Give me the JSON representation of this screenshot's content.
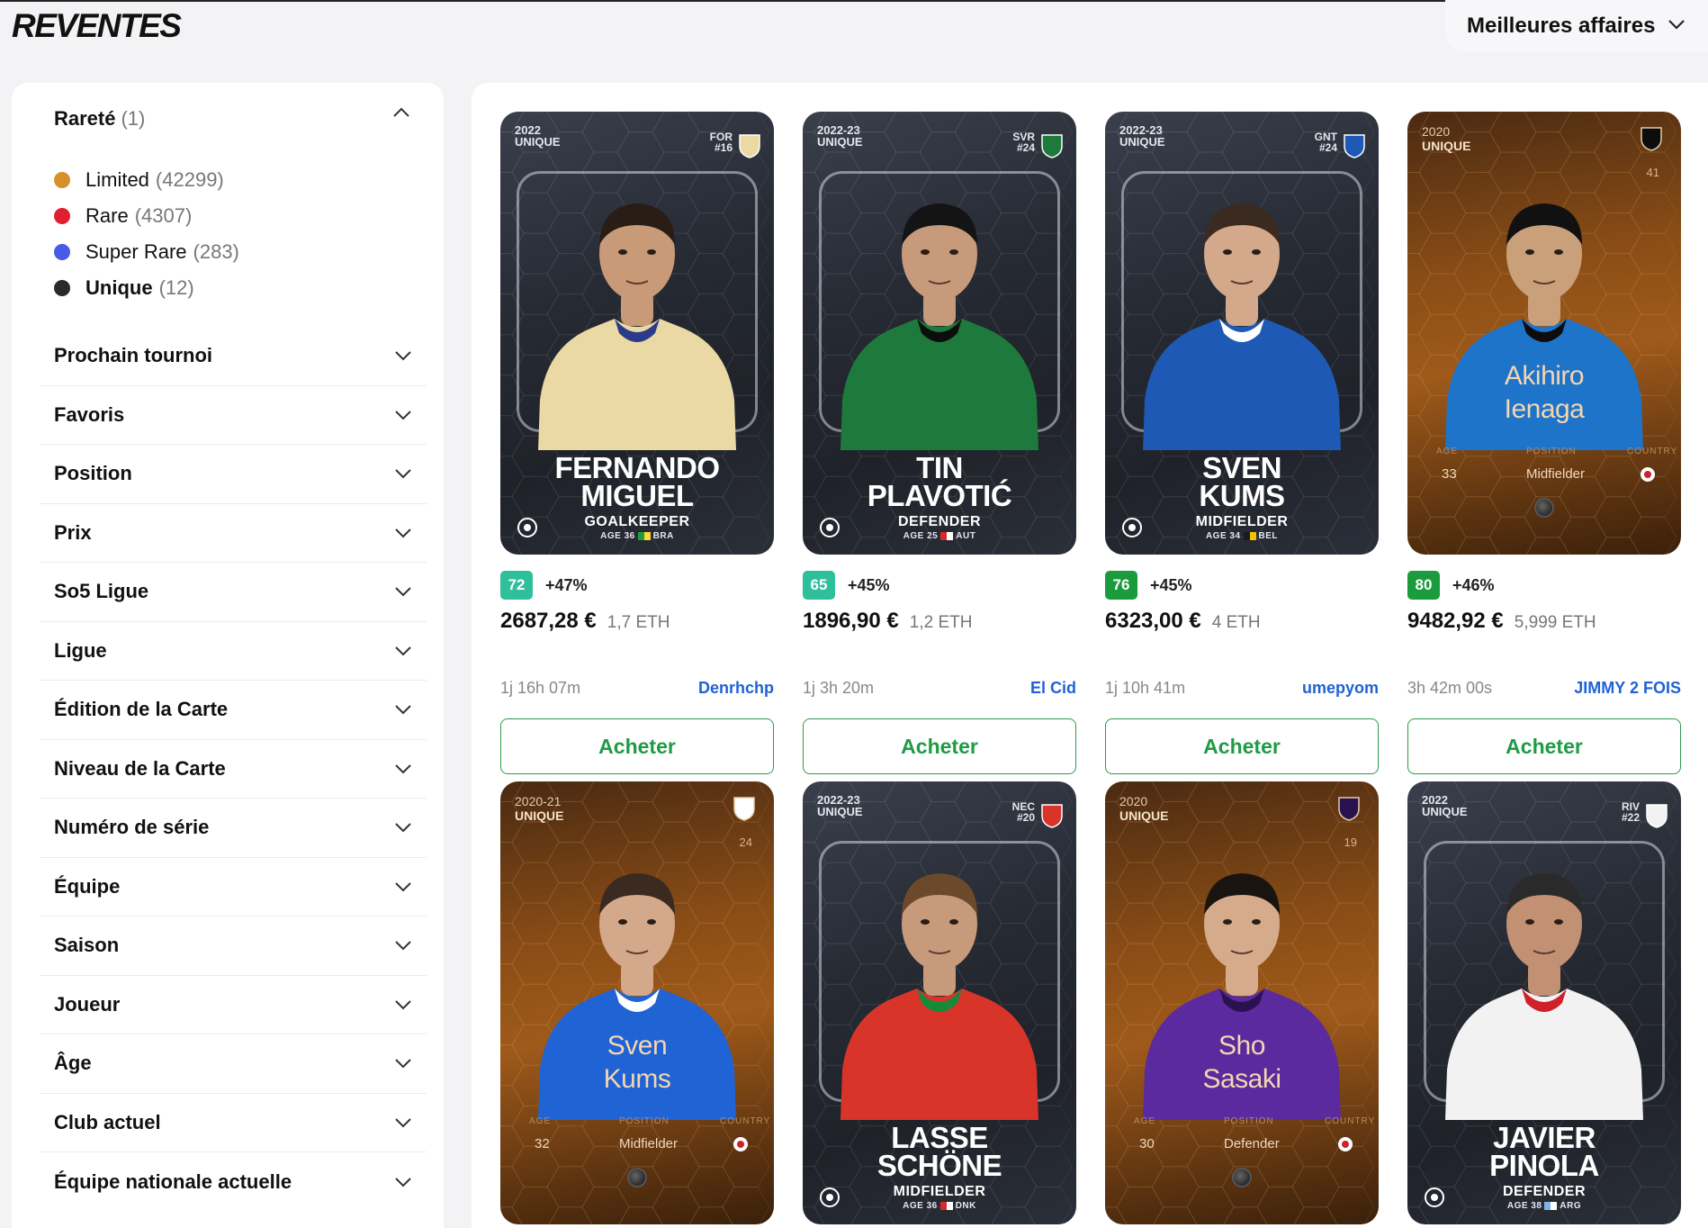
{
  "page": {
    "title": "REVENTES"
  },
  "sort": {
    "label": "Meilleures affaires"
  },
  "sidebar": {
    "rarete": {
      "label": "Rareté",
      "count": "(1)"
    },
    "rarities": [
      {
        "name": "Limited",
        "count": "(42299)",
        "color": "#d4912a"
      },
      {
        "name": "Rare",
        "count": "(4307)",
        "color": "#e02030"
      },
      {
        "name": "Super Rare",
        "count": "(283)",
        "color": "#4a5ae8"
      },
      {
        "name": "Unique",
        "count": "(12)",
        "color": "#2a2a2a"
      }
    ],
    "filters": [
      "Prochain tournoi",
      "Favoris",
      "Position",
      "Prix",
      "So5 Ligue",
      "Ligue",
      "Édition de la Carte",
      "Niveau de la Carte",
      "Numéro de série",
      "Équipe",
      "Saison",
      "Joueur",
      "Âge",
      "Club actuel",
      "Équipe nationale actuelle"
    ]
  },
  "listings": [
    {
      "style": "holo",
      "season": "2022",
      "rarity": "UNIQUE",
      "club": "FOR",
      "number": "#16",
      "name1": "FERNANDO",
      "name2": "MIGUEL",
      "position": "GOALKEEPER",
      "age": "AGE 36",
      "country": "BRA",
      "score": "72",
      "score_color": "#2fbf9b",
      "pct": "+47%",
      "eur": "2687,28 €",
      "eth": "1,7 ETH",
      "time": "1j 16h 07m",
      "seller": "Denrhchp",
      "buy": "Acheter"
    },
    {
      "style": "holo",
      "season": "2022-23",
      "rarity": "UNIQUE",
      "club": "SVR",
      "number": "#24",
      "name1": "TIN",
      "name2": "PLAVOTIĆ",
      "position": "DEFENDER",
      "age": "AGE 25",
      "country": "AUT",
      "score": "65",
      "score_color": "#2fbf9b",
      "pct": "+45%",
      "eur": "1896,90 €",
      "eth": "1,2 ETH",
      "time": "1j 3h 20m",
      "seller": "El Cid",
      "buy": "Acheter"
    },
    {
      "style": "holo",
      "season": "2022-23",
      "rarity": "UNIQUE",
      "club": "GNT",
      "number": "#24",
      "name1": "SVEN",
      "name2": "KUMS",
      "position": "MIDFIELDER",
      "age": "AGE 34",
      "country": "BEL",
      "score": "76",
      "score_color": "#1a9b3c",
      "pct": "+45%",
      "eur": "6323,00 €",
      "eth": "4 ETH",
      "time": "1j 10h 41m",
      "seller": "umepyom",
      "buy": "Acheter"
    },
    {
      "style": "gold",
      "season": "2020",
      "rarity": "UNIQUE",
      "number": "41",
      "name1": "Akihiro",
      "name2": "Ienaga",
      "age_label": "AGE",
      "position_label": "POSITION",
      "country_label": "COUNTRY",
      "age": "33",
      "position": "Midfielder",
      "score": "80",
      "score_color": "#1a9b3c",
      "pct": "+46%",
      "eur": "9482,92 €",
      "eth": "5,999 ETH",
      "time": "3h 42m 00s",
      "seller": "JIMMY 2 FOIS",
      "buy": "Acheter"
    },
    {
      "style": "gold",
      "season": "2020-21",
      "rarity": "UNIQUE",
      "number": "24",
      "name1": "Sven",
      "name2": "Kums",
      "age_label": "AGE",
      "position_label": "POSITION",
      "country_label": "COUNTRY",
      "age": "32",
      "position": "Midfielder"
    },
    {
      "style": "holo",
      "season": "2022-23",
      "rarity": "UNIQUE",
      "club": "NEC",
      "number": "#20",
      "name1": "LASSE",
      "name2": "SCHÖNE",
      "position": "MIDFIELDER",
      "age": "AGE 36",
      "country": "DNK"
    },
    {
      "style": "gold",
      "season": "2020",
      "rarity": "UNIQUE",
      "number": "19",
      "name1": "Sho",
      "name2": "Sasaki",
      "age_label": "AGE",
      "position_label": "POSITION",
      "country_label": "COUNTRY",
      "age": "30",
      "position": "Defender"
    },
    {
      "style": "holo",
      "season": "2022",
      "rarity": "UNIQUE",
      "club": "RIV",
      "number": "#22",
      "name1": "JAVIER",
      "name2": "PINOLA",
      "position": "DEFENDER",
      "age": "AGE 38",
      "country": "ARG"
    }
  ]
}
